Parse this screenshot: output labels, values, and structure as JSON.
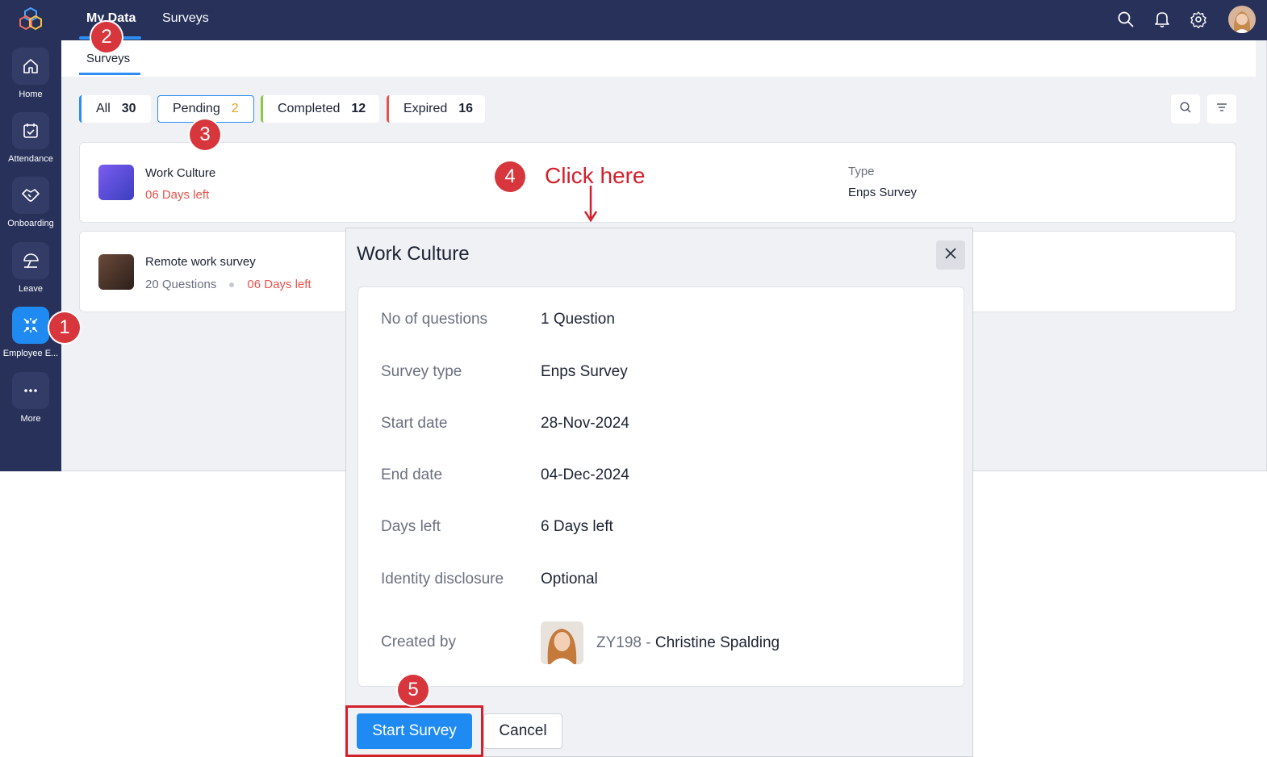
{
  "sidebar": {
    "items": [
      {
        "label": "Home",
        "icon": "home-icon"
      },
      {
        "label": "Attendance",
        "icon": "calendar-check-icon"
      },
      {
        "label": "Onboarding",
        "icon": "handshake-icon"
      },
      {
        "label": "Leave",
        "icon": "umbrella-icon"
      },
      {
        "label": "Employee E...",
        "icon": "engagement-icon"
      },
      {
        "label": "More",
        "icon": "more-icon"
      }
    ]
  },
  "topbar": {
    "tabs": [
      "My Data",
      "Surveys"
    ]
  },
  "subnav": {
    "tab": "Surveys"
  },
  "filters": {
    "all": {
      "label": "All",
      "count": "30"
    },
    "pending": {
      "label": "Pending",
      "count": "2"
    },
    "completed": {
      "label": "Completed",
      "count": "12"
    },
    "expired": {
      "label": "Expired",
      "count": "16"
    }
  },
  "surveys": [
    {
      "title": "Work Culture",
      "days_left": "06 Days left",
      "type_label": "Type",
      "type_value": "Enps Survey"
    },
    {
      "title": "Remote work survey",
      "questions": "20 Questions",
      "days_left": "06 Days left"
    }
  ],
  "modal": {
    "title": "Work Culture",
    "rows": [
      {
        "label": "No of questions",
        "value": "1 Question"
      },
      {
        "label": "Survey type",
        "value": "Enps Survey"
      },
      {
        "label": "Start date",
        "value": "28-Nov-2024"
      },
      {
        "label": "End date",
        "value": "04-Dec-2024"
      },
      {
        "label": "Days left",
        "value": "6 Days left"
      },
      {
        "label": "Identity disclosure",
        "value": "Optional"
      }
    ],
    "created_by_label": "Created by",
    "creator_id": "ZY198 -",
    "creator_name": "Christine Spalding",
    "start_label": "Start Survey",
    "cancel_label": "Cancel"
  },
  "annotations": {
    "steps": [
      "1",
      "2",
      "3",
      "4",
      "5"
    ],
    "click_here": "Click here"
  },
  "colors": {
    "sidebar_bg": "#27315a",
    "accent": "#1f8bf2",
    "danger": "#e5534b",
    "pending": "#e8a21f",
    "completed": "#8dc63f",
    "annotation_red": "#d51f2b"
  }
}
